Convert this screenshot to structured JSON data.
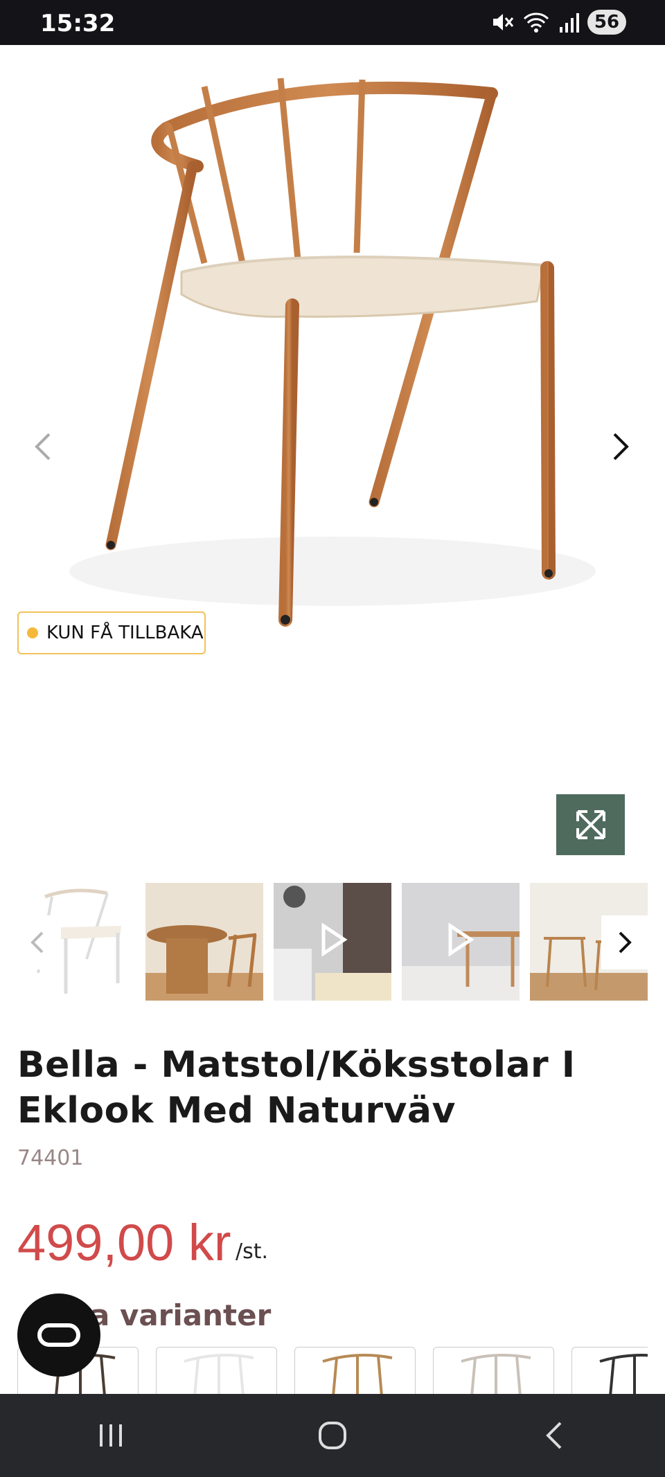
{
  "status_bar": {
    "time": "15:32",
    "battery": "56"
  },
  "product": {
    "badge": "KUN FÅ TILLBAKA",
    "title": "Bella - Matstol/Köksstolar I Eklook Med Naturväv",
    "sku": "74401",
    "price": "499,00 kr",
    "unit": "/st.",
    "variants_heading": "a varianter"
  },
  "colors": {
    "accent": "#d14a4a",
    "expand_bg": "#4f6b5e",
    "badge_border": "#f0c25a"
  },
  "icons": [
    "mute-icon",
    "wifi-icon",
    "signal-icon",
    "chevron-left-icon",
    "chevron-right-icon",
    "expand-icon",
    "play-icon",
    "chat-icon",
    "recents-icon",
    "home-icon",
    "back-icon"
  ]
}
